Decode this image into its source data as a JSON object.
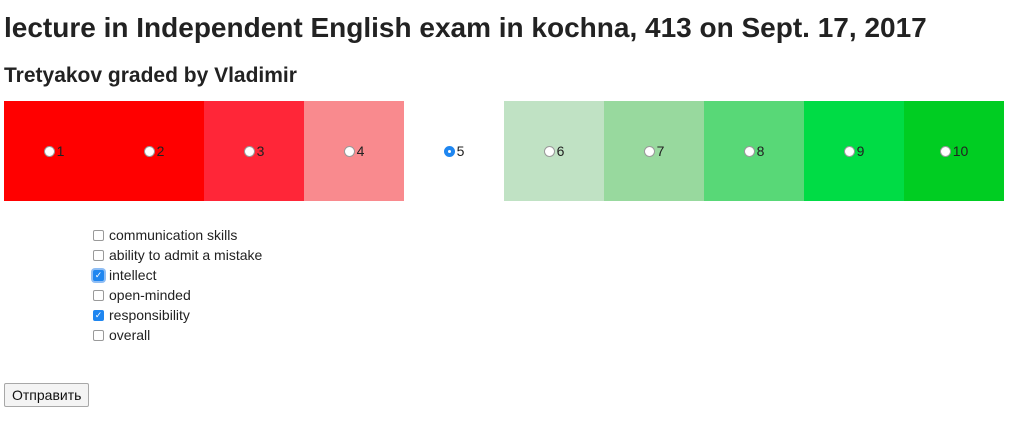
{
  "header": {
    "title": "lecture in Independent English exam in kochna, 413 on Sept. 17, 2017",
    "subtitle": "Tretyakov graded by Vladimir"
  },
  "grade_scale": {
    "selected": "5",
    "options": [
      {
        "label": "1",
        "color": "#ff0000"
      },
      {
        "label": "2",
        "color": "#ff0000"
      },
      {
        "label": "3",
        "color": "#ff2638"
      },
      {
        "label": "4",
        "color": "#f98a8e"
      },
      {
        "label": "5",
        "color": "#ffffff"
      },
      {
        "label": "6",
        "color": "#c0e2c4"
      },
      {
        "label": "7",
        "color": "#98d99e"
      },
      {
        "label": "8",
        "color": "#58d877"
      },
      {
        "label": "9",
        "color": "#00dc45"
      },
      {
        "label": "10",
        "color": "#00cd22"
      }
    ]
  },
  "qualities": [
    {
      "label": "communication skills",
      "checked": false
    },
    {
      "label": "ability to admit a mistake",
      "checked": false
    },
    {
      "label": "intellect",
      "checked": true
    },
    {
      "label": "open-minded",
      "checked": false
    },
    {
      "label": "responsibility",
      "checked": true
    },
    {
      "label": "overall",
      "checked": false
    }
  ],
  "submit_label": "Отправить"
}
